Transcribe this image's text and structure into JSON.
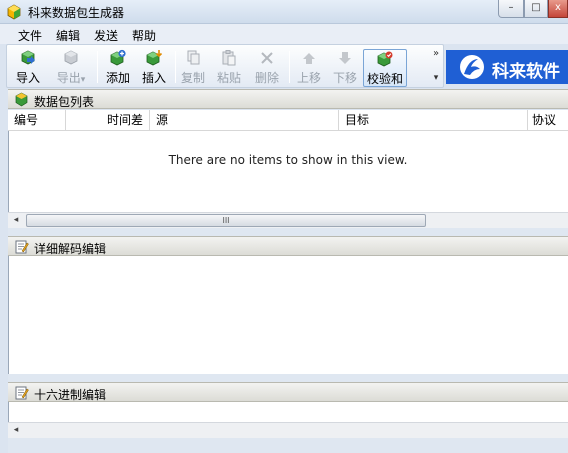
{
  "window": {
    "title": "科来数据包生成器",
    "controls": {
      "minimize": "–",
      "maximize": "□",
      "close": "x"
    }
  },
  "menu": [
    {
      "label": "文件"
    },
    {
      "label": "编辑"
    },
    {
      "label": "发送"
    },
    {
      "label": "帮助"
    }
  ],
  "toolbar": {
    "import": "导入",
    "export": "导出",
    "add": "添加",
    "insert": "插入",
    "copy": "复制",
    "paste": "粘贴",
    "delete": "删除",
    "move_up": "上移",
    "move_down": "下移",
    "checksum": "校验和",
    "overflow_chevron": "»",
    "dropdown_arrow": "▾"
  },
  "logo": {
    "text": "科来软件"
  },
  "packet_list": {
    "header": "数据包列表",
    "columns": [
      "编号",
      "时间差",
      "源",
      "目标",
      "协议"
    ],
    "empty_message": "There are no items to show in this view."
  },
  "decode_panel": {
    "header": "详细解码编辑"
  },
  "hex_panel": {
    "header": "十六进制编辑"
  },
  "scrollbar": {
    "left_arrow": "◂",
    "right_arrow": "▸",
    "grip": "III"
  },
  "colors": {
    "logo_bg": "#1f5fd4",
    "accent": "#2f7fd6"
  }
}
